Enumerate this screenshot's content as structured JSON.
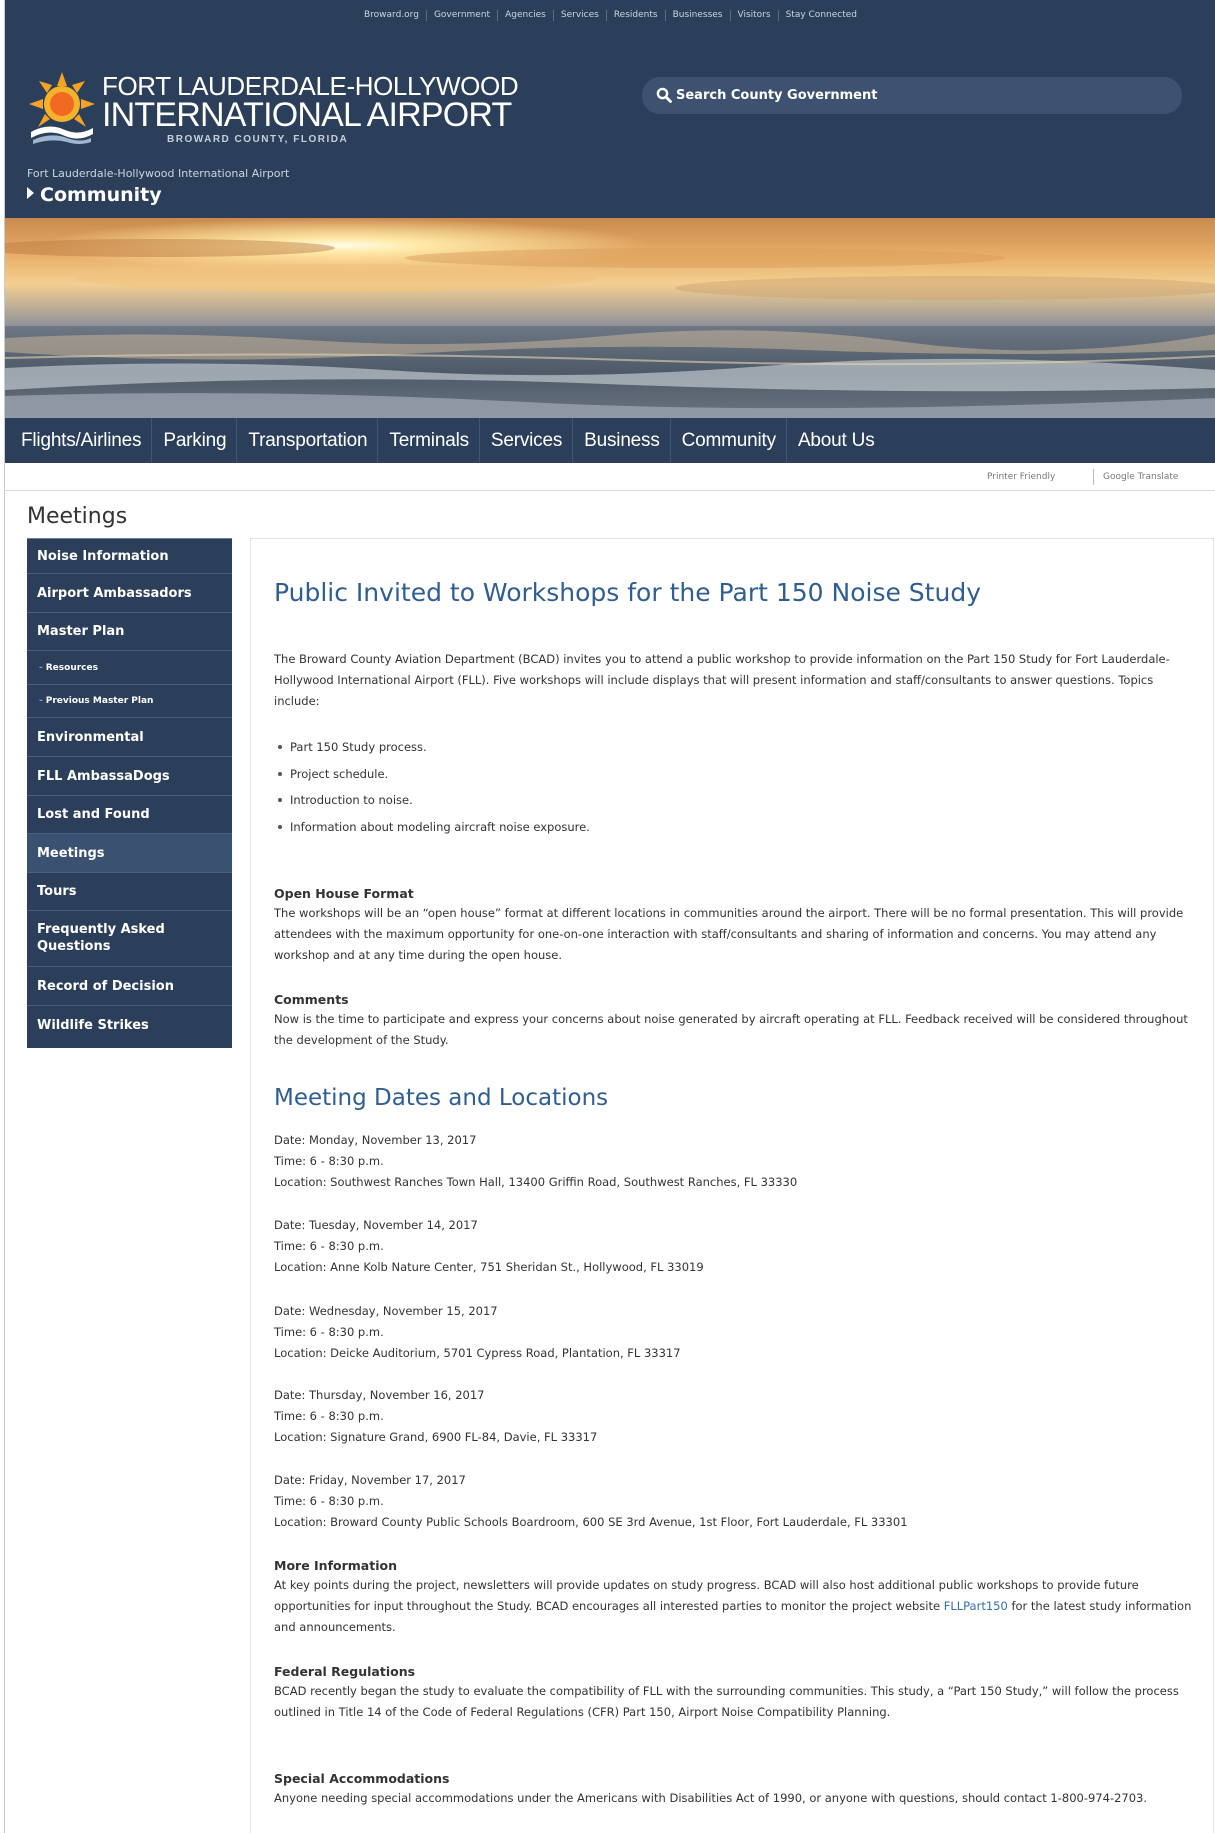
{
  "top_links": [
    "Broward.org",
    "Government",
    "Agencies",
    "Services",
    "Residents",
    "Businesses",
    "Visitors",
    "Stay Connected"
  ],
  "logo": {
    "line1": "FORT LAUDERDALE-HOLLYWOOD",
    "line2": "INTERNATIONAL AIRPORT",
    "line3": "BROWARD COUNTY, FLORIDA"
  },
  "search": {
    "placeholder": "Search County Government"
  },
  "breadcrumb": {
    "site": "Fort Lauderdale-Hollywood International Airport",
    "section": "Community"
  },
  "main_nav": [
    "Flights/Airlines",
    "Parking",
    "Transportation",
    "Terminals",
    "Services",
    "Business",
    "Community",
    "About Us"
  ],
  "utility": {
    "printer": "Printer Friendly",
    "translate": "Google Translate"
  },
  "page_heading": "Meetings",
  "sidebar": [
    {
      "label": "Noise Information"
    },
    {
      "label": "Airport Ambassadors"
    },
    {
      "label": "Master Plan"
    },
    {
      "label": "Resources"
    },
    {
      "label": "Previous Master Plan"
    },
    {
      "label": "Environmental"
    },
    {
      "label": "FLL AmbassaDogs"
    },
    {
      "label": "Lost and Found"
    },
    {
      "label": "Meetings"
    },
    {
      "label": "Tours"
    },
    {
      "label": "Frequently Asked Questions"
    },
    {
      "label": "Record of Decision"
    },
    {
      "label": "Wildlife Strikes"
    }
  ],
  "article": {
    "title": "Public Invited to Workshops for the Part 150 Noise Study",
    "intro": "The Broward County Aviation Department (BCAD) invites you to attend a public workshop to provide information on the Part 150 Study for Fort Lauderdale-Hollywood International Airport (FLL). Five workshops will include displays that will present information and staff/consultants to answer questions. Topics include:",
    "topics": [
      "Part 150 Study process.",
      "Project schedule.",
      "Introduction to noise.",
      "Information about modeling aircraft noise exposure."
    ],
    "open_house_heading": "Open House Format",
    "open_house_text": "The workshops will be an “open house” format at different locations in communities around the airport. There will be no formal presentation. This will provide attendees with the maximum opportunity for one-on-one interaction with staff/consultants and sharing of information and concerns. You may attend any workshop and at any time during the open house.",
    "comments_heading": "Comments",
    "comments_text": "Now is the time to participate and express your concerns about noise generated by aircraft operating at FLL. Feedback received will be considered throughout the development of the Study.",
    "meetings_heading": "Meeting Dates and Locations",
    "meetings": [
      {
        "date": "Date: Monday, November 13, 2017",
        "time": "Time: 6 - 8:30 p.m.",
        "location": "Location: Southwest Ranches Town Hall, 13400 Griffin Road, Southwest Ranches, FL 33330"
      },
      {
        "date": "Date: Tuesday, November 14, 2017",
        "time": "Time: 6 - 8:30 p.m.",
        "location": "Location: Anne Kolb Nature Center, 751 Sheridan St., Hollywood, FL 33019"
      },
      {
        "date": "Date: Wednesday, November 15, 2017",
        "time": "Time: 6 - 8:30 p.m.",
        "location": "Location: Deicke Auditorium, 5701 Cypress Road, Plantation, FL 33317"
      },
      {
        "date": "Date: Thursday, November 16, 2017",
        "time": "Time: 6 - 8:30 p.m.",
        "location": "Location: Signature Grand, 6900 FL-84, Davie, FL 33317"
      },
      {
        "date": "Date: Friday, November 17, 2017",
        "time": "Time: 6 - 8:30 p.m.",
        "location": "Location: Broward County Public Schools Boardroom, 600 SE 3rd Avenue, 1st Floor, Fort Lauderdale, FL 33301"
      }
    ],
    "more_info_heading": "More Information",
    "more_info_before": "At key points during the project, newsletters will provide updates on study progress. BCAD will also host additional public workshops to provide future opportunities for input throughout the Study. BCAD encourages all interested parties to monitor the project website ",
    "more_info_link": "FLLPart150",
    "more_info_after": " for the latest study information and announcements.",
    "federal_heading": "Federal Regulations",
    "federal_text": "BCAD recently began the study to evaluate the compatibility of FLL with the surrounding communities. This study, a “Part 150 Study,” will follow the process outlined in Title 14 of the Code of Federal Regulations (CFR) Part 150, Airport Noise Compatibility Planning.",
    "special_heading": "Special Accommodations",
    "special_text": "Anyone needing special accommodations under the Americans with Disabilities Act of 1990, or anyone with questions, should contact 1-800-974-2703."
  },
  "colors": {
    "header": "#2b3f5b",
    "heading_blue": "#2f5e93",
    "link": "#2f6fb4"
  }
}
